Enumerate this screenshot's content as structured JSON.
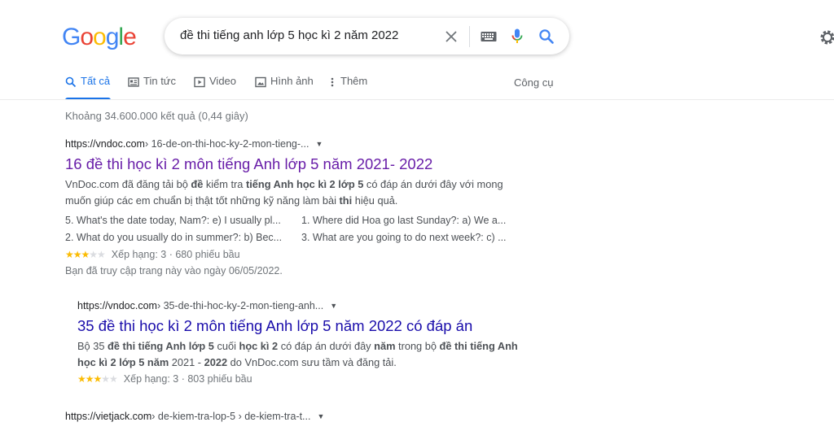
{
  "logo": {
    "letters": [
      "G",
      "o",
      "o",
      "g",
      "l",
      "e"
    ],
    "colors": [
      "#4285f4",
      "#ea4335",
      "#fbbc05",
      "#4285f4",
      "#34a853",
      "#ea4335"
    ]
  },
  "search": {
    "query": "đề thi tiếng anh lớp 5 học kì 2 năm 2022"
  },
  "tabs": [
    {
      "label": "Tất cả",
      "icon": "search-icon"
    },
    {
      "label": "Tin tức",
      "icon": "news-icon"
    },
    {
      "label": "Video",
      "icon": "video-icon"
    },
    {
      "label": "Hình ảnh",
      "icon": "image-icon"
    },
    {
      "label": "Thêm",
      "icon": "more-vert-icon"
    }
  ],
  "tools_label": "Công cụ",
  "stats": "Khoảng 34.600.000 kết quả (0,44 giây)",
  "results": [
    {
      "site": "https://vndoc.com",
      "path": " › 16-de-on-thi-hoc-ky-2-mon-tieng-...",
      "title": "16 đề thi học kì 2 môn tiếng Anh lớp 5 năm 2021- 2022",
      "qa": [
        {
          "q": "5. What's the date today, Nam?:",
          "a": " e) I usually pl..."
        },
        {
          "q": "1. Where did Hoa go last Sunday?:",
          "a": " a) We a..."
        },
        {
          "q": "2. What do you usually do in summer?:",
          "a": " b) Bec..."
        },
        {
          "q": "3. What are you going to do next week?:",
          "a": " c) ..."
        }
      ],
      "rating": "Xếp hạng: 3 · 680 phiếu bầu",
      "stars": 3,
      "visited": "Bạn đã truy cập trang này vào ngày 06/05/2022."
    },
    {
      "site": "https://vndoc.com",
      "path": " › 35-de-thi-hoc-ky-2-mon-tieng-anh...",
      "title": "35 đề thi học kì 2 môn tiếng Anh lớp 5 năm 2022 có đáp án",
      "rating": "Xếp hạng: 3 · 803 phiếu bầu",
      "stars": 3
    },
    {
      "site": "https://vietjack.com",
      "path": " › de-kiem-tra-lop-5 › de-kiem-tra-t..."
    }
  ],
  "snippets": {
    "r1_a": "VnDoc.com đã đăng tải bộ ",
    "r1_b": "đề",
    "r1_c": " kiểm tra ",
    "r1_d": "tiếng Anh học kì 2 lớp 5",
    "r1_e": " có đáp án dưới đây với mong muốn giúp các em chuẩn bị thật tốt những kỹ năng làm bài ",
    "r1_f": "thi",
    "r1_g": " hiệu quả.",
    "r2_a": "Bộ 35 ",
    "r2_b": "đề thi tiếng Anh lớp 5",
    "r2_c": " cuối ",
    "r2_d": "học kì 2",
    "r2_e": " có đáp án dưới đây ",
    "r2_f": "năm",
    "r2_g": " trong bộ ",
    "r2_h": "đề thi tiếng Anh học kì 2 lớp 5 năm",
    "r2_i": " 2021 - ",
    "r2_j": "2022",
    "r2_k": " do VnDoc.com sưu tầm và đăng tải."
  }
}
